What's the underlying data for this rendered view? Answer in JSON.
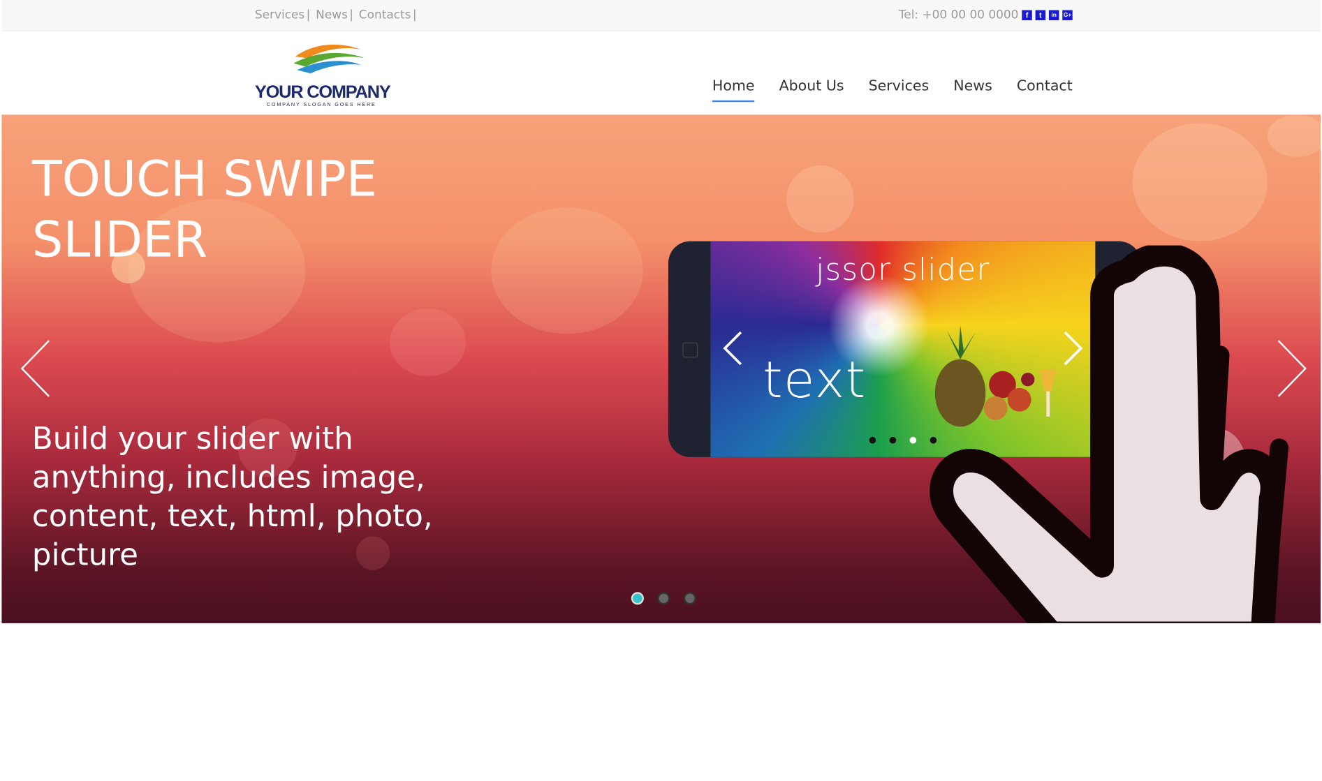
{
  "topbar": {
    "links": [
      {
        "label": "Services"
      },
      {
        "label": "News"
      },
      {
        "label": "Contacts"
      }
    ],
    "separator": "|",
    "phone": "Tel: +00 00 00 0000",
    "social": [
      {
        "icon": "facebook-icon",
        "glyph": "f"
      },
      {
        "icon": "twitter-icon",
        "glyph": "t"
      },
      {
        "icon": "linkedin-icon",
        "glyph": "in"
      },
      {
        "icon": "google-plus-icon",
        "glyph": "G+"
      }
    ]
  },
  "header": {
    "logo": {
      "name": "YOUR COMPANY",
      "slogan": "COMPANY SLOGAN GOES HERE"
    },
    "nav": [
      {
        "label": "Home",
        "active": true
      },
      {
        "label": "About Us"
      },
      {
        "label": "Services"
      },
      {
        "label": "News"
      },
      {
        "label": "Contact"
      }
    ]
  },
  "slider": {
    "headline": "TOUCH SWIPE SLIDER",
    "subtext": "Build your slider with anything, includes image, content, text, html, photo, picture",
    "phone": {
      "title": "jssor slider",
      "text": "text",
      "dots_active_index": 2
    },
    "bullets_active_index": 0,
    "colors": {
      "bullet_active": "#36c2c8",
      "nav_underline": "#3b82f6"
    }
  }
}
